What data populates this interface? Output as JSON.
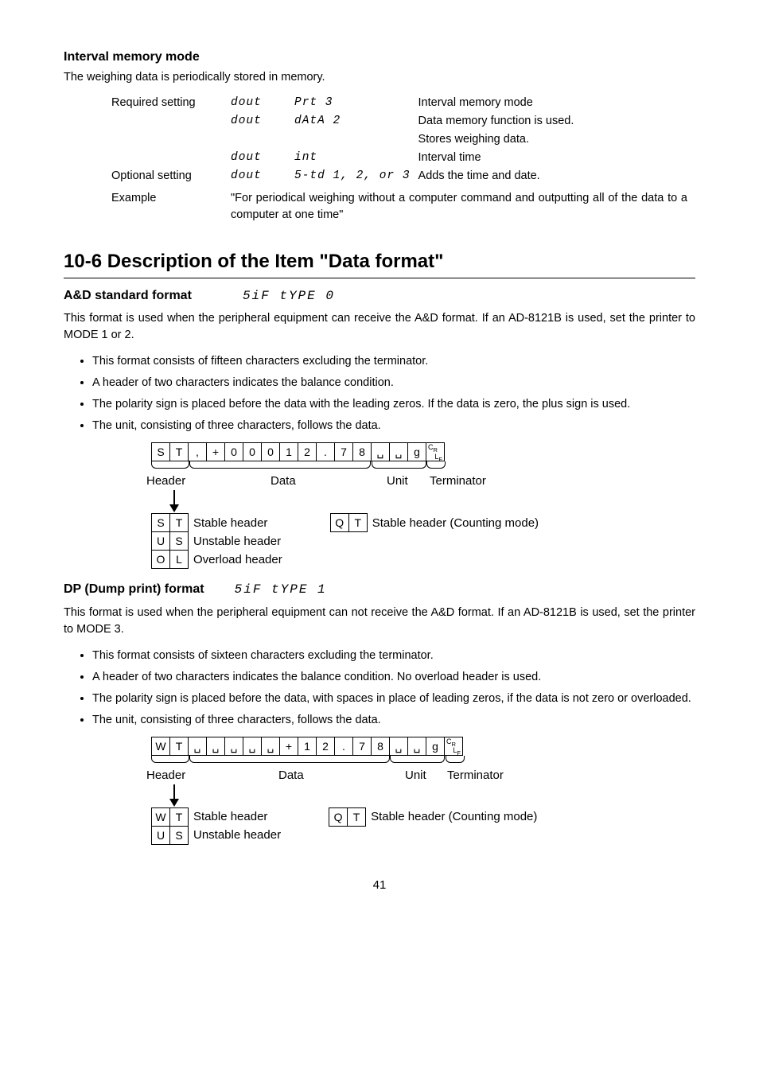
{
  "interval_mode": {
    "heading": "Interval memory mode",
    "intro": "The weighing data is periodically stored in memory.",
    "rows": [
      {
        "label": "Required setting",
        "seg1": "dout",
        "seg2": "Prt 3",
        "desc": "Interval memory mode"
      },
      {
        "label": "",
        "seg1": "dout",
        "seg2": "dAtA 2",
        "desc": "Data memory function is used."
      },
      {
        "label": "",
        "seg1": "",
        "seg2": "",
        "desc": "Stores weighing data."
      },
      {
        "label": "",
        "seg1": "dout",
        "seg2": "int",
        "desc": "Interval time"
      },
      {
        "label": "Optional setting",
        "seg1": "dout",
        "seg2": "5-td 1, 2, or 3",
        "desc": "Adds the time and date."
      }
    ],
    "example_label": "Example",
    "example_text": "\"For periodical weighing without a computer command and outputting all of the data to a computer at one time\""
  },
  "main_heading": "10-6  Description of the Item \"Data format\"",
  "ad_format": {
    "heading": "A&D standard format",
    "seg": "5iF tYPE 0",
    "para": "This format is used when the peripheral equipment can receive the A&D format. If an AD-8121B is used, set the printer to MODE 1 or 2.",
    "bullets": [
      "This format consists of fifteen characters excluding the terminator.",
      "A header of two characters indicates the balance condition.",
      "The polarity sign is placed before the data with the leading zeros. If the data is zero, the plus sign is used.",
      "The unit, consisting of three characters, follows the data."
    ],
    "cells": [
      "S",
      "T",
      ",",
      "+",
      "0",
      "0",
      "0",
      "1",
      "2",
      ".",
      "7",
      "8",
      "␣",
      "␣",
      "g",
      "CRLF"
    ],
    "labels": {
      "header": "Header",
      "data": "Data",
      "unit": "Unit",
      "terminator": "Terminator"
    },
    "headers": [
      {
        "c1": "S",
        "c2": "T",
        "desc": "Stable header"
      },
      {
        "c1": "U",
        "c2": "S",
        "desc": "Unstable header"
      },
      {
        "c1": "O",
        "c2": "L",
        "desc": "Overload header"
      }
    ],
    "qt": {
      "c1": "Q",
      "c2": "T",
      "desc": "Stable header (Counting mode)"
    }
  },
  "dp_format": {
    "heading": "DP (Dump print) format",
    "seg": "5iF tYPE 1",
    "para": "This format is used when the peripheral equipment can not receive the A&D format. If an AD-8121B is used, set the printer to MODE 3.",
    "bullets": [
      "This format consists of sixteen characters excluding the terminator.",
      "A header of two characters indicates the balance condition. No overload header is used.",
      "The polarity sign is placed before the data, with spaces in place of leading zeros, if the data is not zero or overloaded.",
      "The unit, consisting of three characters, follows the data."
    ],
    "cells": [
      "W",
      "T",
      "␣",
      "␣",
      "␣",
      "␣",
      "␣",
      "+",
      "1",
      "2",
      ".",
      "7",
      "8",
      "␣",
      "␣",
      "g",
      "CRLF"
    ],
    "labels": {
      "header": "Header",
      "data": "Data",
      "unit": "Unit",
      "terminator": "Terminator"
    },
    "headers": [
      {
        "c1": "W",
        "c2": "T",
        "desc": "Stable header"
      },
      {
        "c1": "U",
        "c2": "S",
        "desc": "Unstable header"
      }
    ],
    "qt": {
      "c1": "Q",
      "c2": "T",
      "desc": "Stable header (Counting mode)"
    }
  },
  "page": "41"
}
